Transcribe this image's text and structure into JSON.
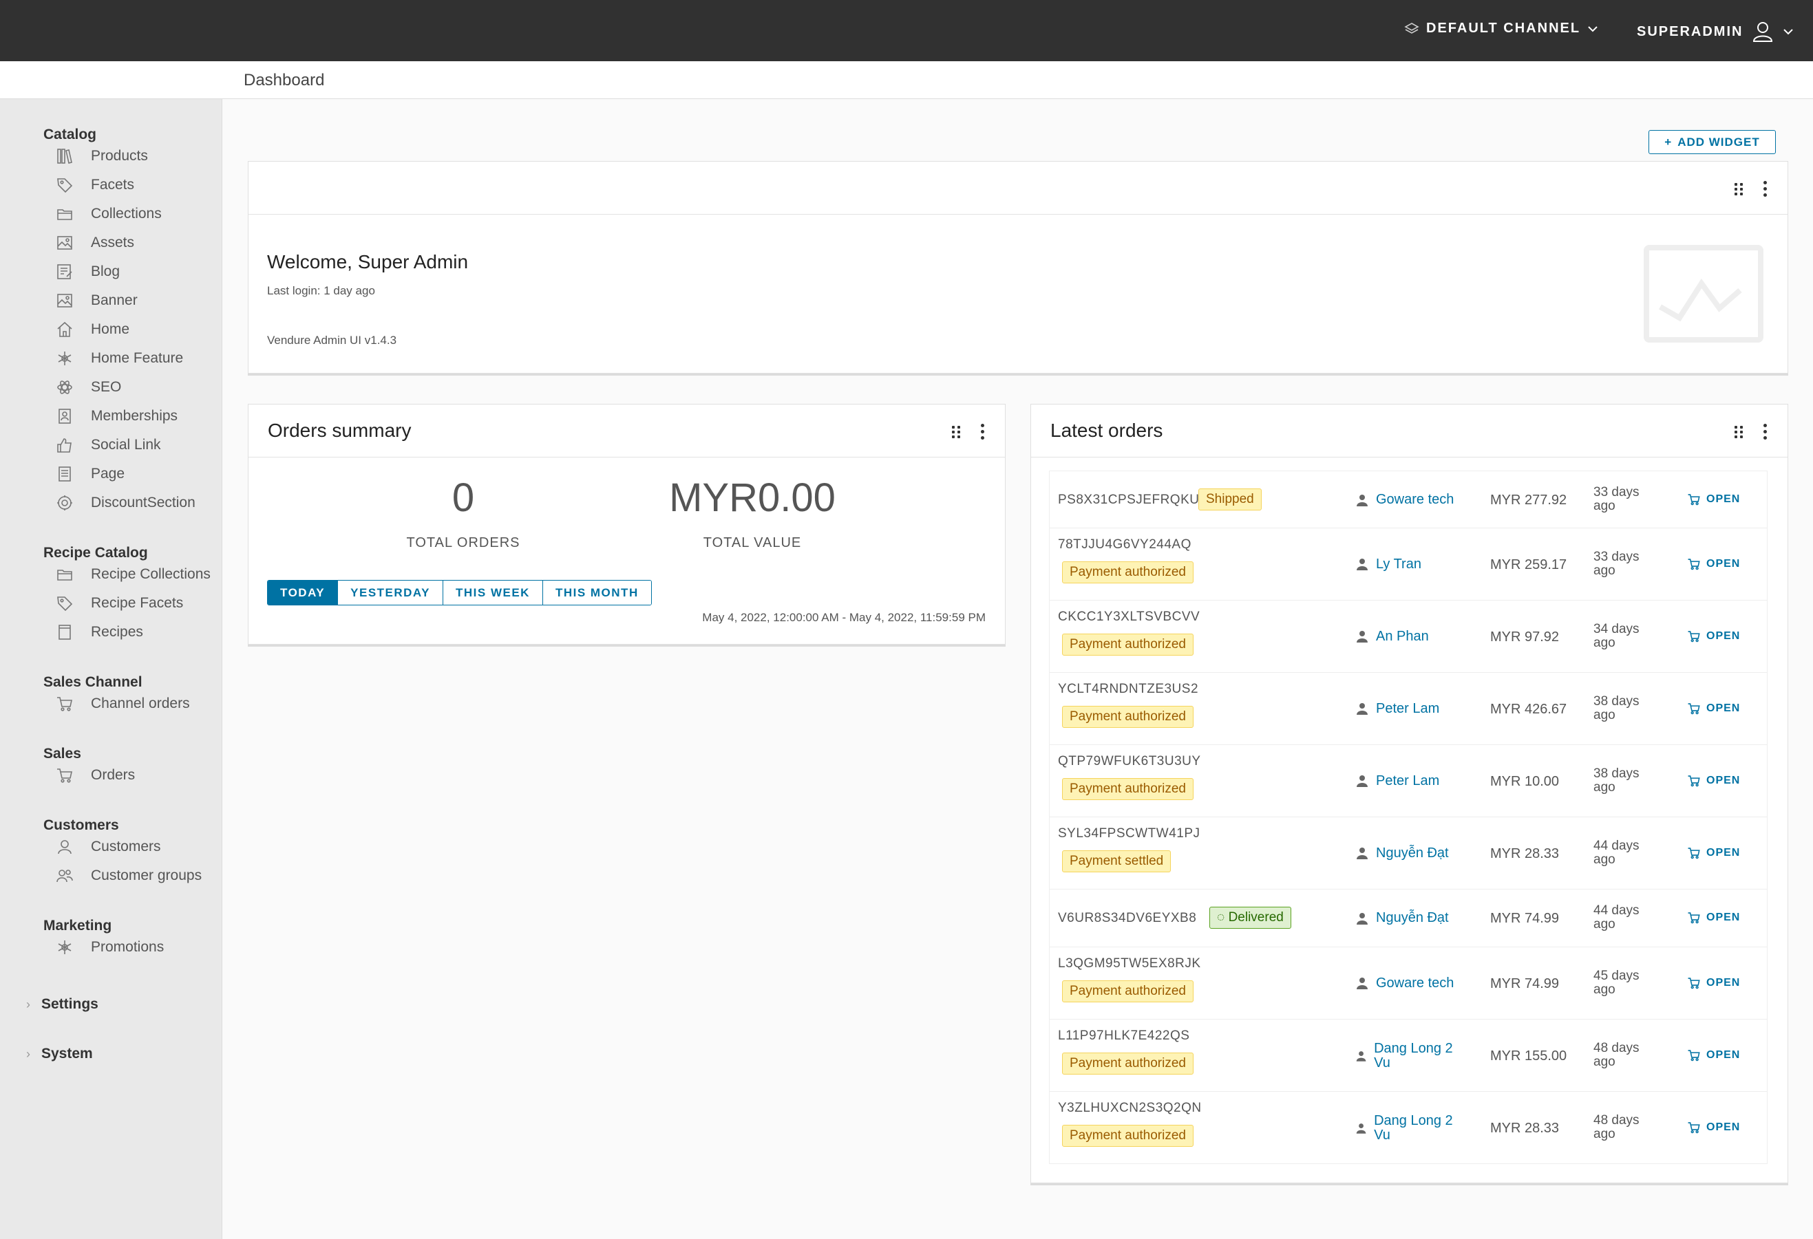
{
  "topbar": {
    "channel_label": "DEFAULT CHANNEL",
    "user_label": "SUPERADMIN"
  },
  "breadcrumb": "Dashboard",
  "sidebar": {
    "sections": [
      {
        "title": "Catalog",
        "items": [
          {
            "label": "Products",
            "icon": "products-icon"
          },
          {
            "label": "Facets",
            "icon": "tag-icon"
          },
          {
            "label": "Collections",
            "icon": "folder-icon"
          },
          {
            "label": "Assets",
            "icon": "image-gallery-icon"
          },
          {
            "label": "Blog",
            "icon": "blog-icon"
          },
          {
            "label": "Banner",
            "icon": "image-icon"
          },
          {
            "label": "Home",
            "icon": "home-icon"
          },
          {
            "label": "Home Feature",
            "icon": "asterisk-icon"
          },
          {
            "label": "SEO",
            "icon": "atom-icon"
          },
          {
            "label": "Memberships",
            "icon": "id-badge-icon"
          },
          {
            "label": "Social Link",
            "icon": "thumbs-up-icon"
          },
          {
            "label": "Page",
            "icon": "page-icon"
          },
          {
            "label": "DiscountSection",
            "icon": "discount-icon"
          }
        ]
      },
      {
        "title": "Recipe Catalog",
        "items": [
          {
            "label": "Recipe Collections",
            "icon": "folder-icon"
          },
          {
            "label": "Recipe Facets",
            "icon": "tag-icon"
          },
          {
            "label": "Recipes",
            "icon": "book-icon"
          }
        ]
      },
      {
        "title": "Sales Channel",
        "items": [
          {
            "label": "Channel orders",
            "icon": "cart-icon"
          }
        ]
      },
      {
        "title": "Sales",
        "items": [
          {
            "label": "Orders",
            "icon": "cart-icon"
          }
        ]
      },
      {
        "title": "Customers",
        "items": [
          {
            "label": "Customers",
            "icon": "user-icon"
          },
          {
            "label": "Customer groups",
            "icon": "users-icon"
          }
        ]
      },
      {
        "title": "Marketing",
        "items": [
          {
            "label": "Promotions",
            "icon": "asterisk-icon"
          }
        ]
      }
    ],
    "collapsed": [
      "Settings",
      "System"
    ]
  },
  "add_widget_label": "ADD WIDGET",
  "welcome": {
    "title": "Welcome, Super Admin",
    "last_login": "Last login: 1 day ago",
    "version": "Vendure Admin UI v1.4.3"
  },
  "summary": {
    "title": "Orders summary",
    "total_orders": "0",
    "total_orders_label": "TOTAL ORDERS",
    "total_value": "MYR0.00",
    "total_value_label": "TOTAL VALUE",
    "ranges": [
      "TODAY",
      "YESTERDAY",
      "THIS WEEK",
      "THIS MONTH"
    ],
    "active_range": "TODAY",
    "range_text": "May 4, 2022, 12:00:00 AM - May 4, 2022, 11:59:59 PM"
  },
  "latest": {
    "title": "Latest orders",
    "open_label": "OPEN",
    "orders": [
      {
        "code": "PS8X31CPSJEFRQKU",
        "state": "Shipped",
        "state_type": "warn",
        "customer": "Goware tech",
        "amount": "MYR 277.92",
        "ago": "33 days ago"
      },
      {
        "code": "78TJJU4G6VY244AQ",
        "state": "Payment authorized",
        "state_type": "warn",
        "customer": "Ly Tran",
        "amount": "MYR 259.17",
        "ago": "33 days ago"
      },
      {
        "code": "CKCC1Y3XLTSVBCVV",
        "state": "Payment authorized",
        "state_type": "warn",
        "customer": "An Phan",
        "amount": "MYR 97.92",
        "ago": "34 days ago"
      },
      {
        "code": "YCLT4RNDNTZE3US2",
        "state": "Payment authorized",
        "state_type": "warn",
        "customer": "Peter Lam",
        "amount": "MYR 426.67",
        "ago": "38 days ago"
      },
      {
        "code": "QTP79WFUK6T3U3UY",
        "state": "Payment authorized",
        "state_type": "warn",
        "customer": "Peter Lam",
        "amount": "MYR 10.00",
        "ago": "38 days ago"
      },
      {
        "code": "SYL34FPSCWTW41PJ",
        "state": "Payment settled",
        "state_type": "warn",
        "customer": "Nguyễn Đạt",
        "amount": "MYR 28.33",
        "ago": "44 days ago"
      },
      {
        "code": "V6UR8S34DV6EYXB8",
        "state": "Delivered",
        "state_type": "ok",
        "customer": "Nguyễn Đạt",
        "amount": "MYR 74.99",
        "ago": "44 days ago"
      },
      {
        "code": "L3QGM95TW5EX8RJK",
        "state": "Payment authorized",
        "state_type": "warn",
        "customer": "Goware tech",
        "amount": "MYR 74.99",
        "ago": "45 days ago"
      },
      {
        "code": "L11P97HLK7E422QS",
        "state": "Payment authorized",
        "state_type": "warn",
        "customer": "Dang Long 2 Vu",
        "amount": "MYR 155.00",
        "ago": "48 days ago"
      },
      {
        "code": "Y3ZLHUXCN2S3Q2QN",
        "state": "Payment authorized",
        "state_type": "warn",
        "customer": "Dang Long 2 Vu",
        "amount": "MYR 28.33",
        "ago": "48 days ago"
      }
    ]
  }
}
